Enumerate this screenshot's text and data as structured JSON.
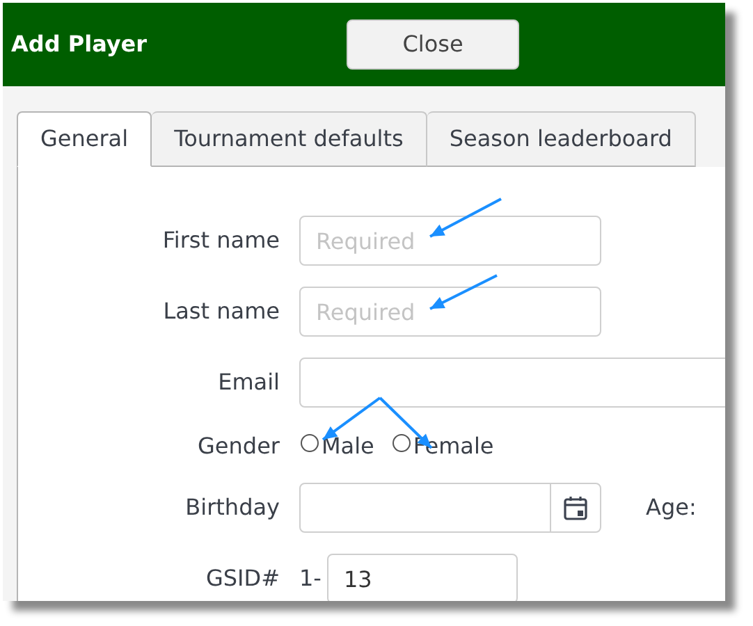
{
  "window": {
    "title": "Add Player"
  },
  "header_buttons": [
    "Close"
  ],
  "tabs": [
    {
      "label": "General",
      "selected": true
    },
    {
      "label": "Tournament defaults",
      "selected": false
    },
    {
      "label": "Season leaderboard",
      "selected": false
    }
  ],
  "fields": [
    {
      "kind": "text",
      "label": "First name",
      "placeholder": "Required"
    },
    {
      "kind": "text",
      "label": "Last name",
      "placeholder": "Required"
    },
    {
      "kind": "wide",
      "label": "Email"
    },
    {
      "kind": "radio",
      "label": "Gender",
      "options": [
        {
          "label": "Male",
          "selected": false
        },
        {
          "label": "Female",
          "selected": false
        }
      ]
    },
    {
      "kind": "date",
      "label": "Birthday",
      "side_label": "Age:"
    },
    {
      "kind": "prefixed",
      "label": "GSID#",
      "prefix": "1-",
      "value": "13"
    }
  ]
}
